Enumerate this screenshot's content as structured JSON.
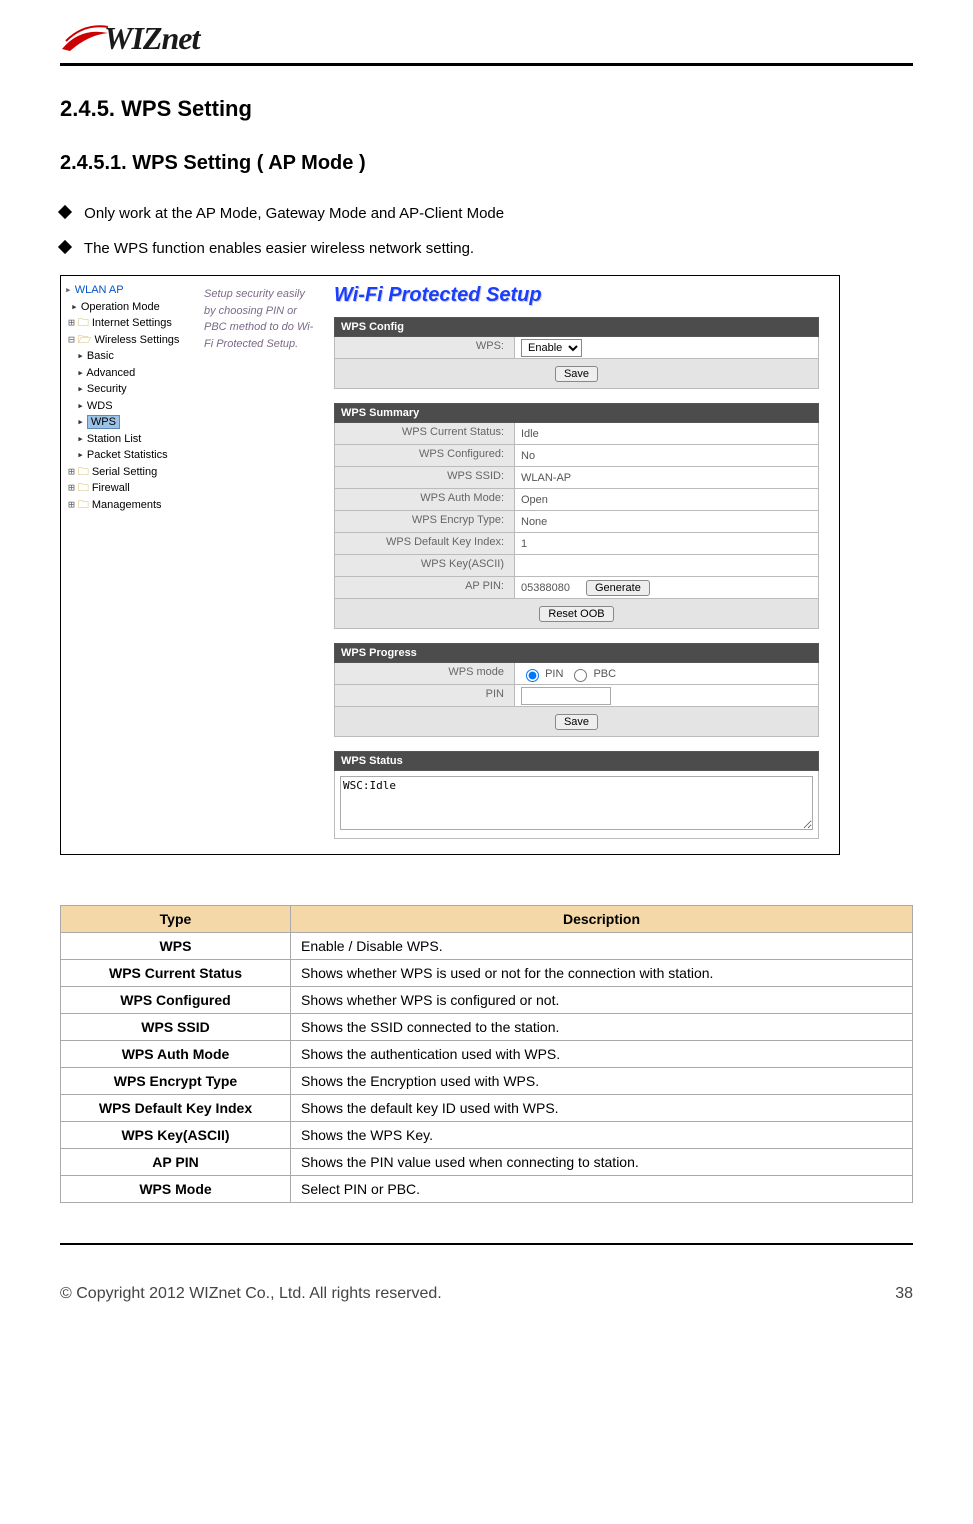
{
  "logo_text": "WIZnet",
  "heading_num": "2.4.5.  WPS  Setting",
  "subheading": "2.4.5.1. WPS Setting ( AP Mode )",
  "bullets": [
    "Only work at the AP Mode, Gateway Mode and AP-Client Mode",
    "The WPS function enables easier wireless network setting."
  ],
  "tree": {
    "root": "WLAN AP",
    "items": [
      "Operation Mode",
      "Internet Settings",
      "Wireless Settings",
      "Basic",
      "Advanced",
      "Security",
      "WDS",
      "WPS",
      "Station List",
      "Packet Statistics",
      "Serial Setting",
      "Firewall",
      "Managements"
    ]
  },
  "blurb": "Setup security easily by choosing PIN or PBC method to do Wi-Fi Protected Setup.",
  "panel": {
    "title": "Wi-Fi Protected Setup",
    "config": {
      "header": "WPS Config",
      "wps_label": "WPS:",
      "wps_value": "Enable",
      "save": "Save"
    },
    "summary": {
      "header": "WPS Summary",
      "rows": [
        {
          "label": "WPS Current Status:",
          "value": "Idle"
        },
        {
          "label": "WPS Configured:",
          "value": "No"
        },
        {
          "label": "WPS SSID:",
          "value": "WLAN-AP"
        },
        {
          "label": "WPS Auth Mode:",
          "value": "Open"
        },
        {
          "label": "WPS Encryp Type:",
          "value": "None"
        },
        {
          "label": "WPS Default Key Index:",
          "value": "1"
        },
        {
          "label": "WPS Key(ASCII)",
          "value": ""
        },
        {
          "label": "AP PIN:",
          "value": "05388080"
        }
      ],
      "generate": "Generate",
      "reset": "Reset OOB"
    },
    "progress": {
      "header": "WPS Progress",
      "mode_label": "WPS mode",
      "pin_opt": "PIN",
      "pbc_opt": "PBC",
      "pin_label": "PIN",
      "save": "Save"
    },
    "status": {
      "header": "WPS Status",
      "text": "WSC:Idle"
    }
  },
  "table": {
    "col_type": "Type",
    "col_desc": "Description",
    "rows": [
      {
        "type": "WPS",
        "desc": "Enable / Disable WPS."
      },
      {
        "type": "WPS Current Status",
        "desc": "Shows whether WPS is used or not for the connection with station."
      },
      {
        "type": "WPS Configured",
        "desc": "Shows whether WPS is configured or not."
      },
      {
        "type": "WPS SSID",
        "desc": "Shows the SSID connected to the station."
      },
      {
        "type": "WPS Auth Mode",
        "desc": "Shows the authentication used with WPS."
      },
      {
        "type": "WPS Encrypt Type",
        "desc": "Shows the Encryption used with WPS."
      },
      {
        "type": "WPS Default Key Index",
        "desc": "Shows the default key ID used with WPS."
      },
      {
        "type": "WPS Key(ASCII)",
        "desc": "Shows the WPS Key."
      },
      {
        "type": "AP PIN",
        "desc": "Shows the PIN value used when connecting to station."
      },
      {
        "type": "WPS Mode",
        "desc": "Select PIN or PBC."
      }
    ]
  },
  "footer": {
    "copyright": "© Copyright 2012 WIZnet Co., Ltd. All rights reserved.",
    "page": "38"
  }
}
